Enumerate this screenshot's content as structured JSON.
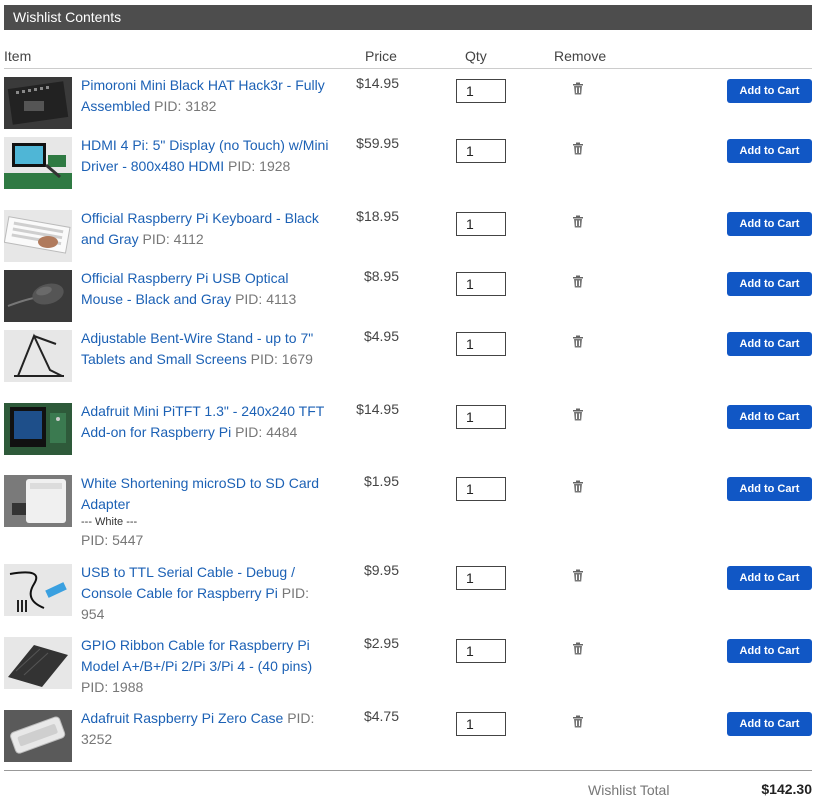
{
  "header": {
    "title": "Wishlist Contents"
  },
  "columns": {
    "item": "Item",
    "price": "Price",
    "qty": "Qty",
    "remove": "Remove"
  },
  "add_to_cart_label": "Add to Cart",
  "items": [
    {
      "name": "Pimoroni Mini Black HAT Hack3r - Fully Assembled",
      "pid_label": "PID:",
      "pid": "3182",
      "price": "$14.95",
      "qty": "1",
      "thumb": "hat-board-image"
    },
    {
      "name": "HDMI 4 Pi: 5\" Display (no Touch) w/Mini Driver - 800x480 HDMI",
      "pid_label": "PID:",
      "pid": "1928",
      "price": "$59.95",
      "qty": "1",
      "thumb": "display-image"
    },
    {
      "name": "Official Raspberry Pi Keyboard - Black and Gray",
      "pid_label": "PID:",
      "pid": "4112",
      "price": "$18.95",
      "qty": "1",
      "thumb": "keyboard-image"
    },
    {
      "name": "Official Raspberry Pi USB Optical Mouse - Black and Gray",
      "pid_label": "PID:",
      "pid": "4113",
      "price": "$8.95",
      "qty": "1",
      "thumb": "mouse-image"
    },
    {
      "name": "Adjustable Bent-Wire Stand - up to 7\" Tablets and Small Screens",
      "pid_label": "PID:",
      "pid": "1679",
      "price": "$4.95",
      "qty": "1",
      "thumb": "stand-image"
    },
    {
      "name": "Adafruit Mini PiTFT 1.3\" - 240x240 TFT Add-on for Raspberry Pi",
      "pid_label": "PID:",
      "pid": "4484",
      "price": "$14.95",
      "qty": "1",
      "thumb": "pitft-image"
    },
    {
      "name": "White Shortening microSD to SD Card Adapter",
      "variant": "--- White ---",
      "pid_label": "PID:",
      "pid": "5447",
      "price": "$1.95",
      "qty": "1",
      "thumb": "sd-adapter-image"
    },
    {
      "name": "USB to TTL Serial Cable - Debug / Console Cable for Raspberry Pi",
      "pid_label": "PID:",
      "pid": "954",
      "price": "$9.95",
      "qty": "1",
      "thumb": "serial-cable-image"
    },
    {
      "name": "GPIO Ribbon Cable for Raspberry Pi Model A+/B+/Pi 2/Pi 3/Pi 4 - (40 pins)",
      "pid_label": "PID:",
      "pid": "1988",
      "price": "$2.95",
      "qty": "1",
      "thumb": "ribbon-cable-image"
    },
    {
      "name": "Adafruit Raspberry Pi Zero Case",
      "pid_label": "PID:",
      "pid": "3252",
      "price": "$4.75",
      "qty": "1",
      "thumb": "zero-case-image"
    }
  ],
  "footer": {
    "total_label": "Wishlist Total",
    "total_value": "$142.30"
  },
  "colors": {
    "header_bg": "#4d4d4d",
    "link": "#1c61b5",
    "button": "#1157c5"
  }
}
